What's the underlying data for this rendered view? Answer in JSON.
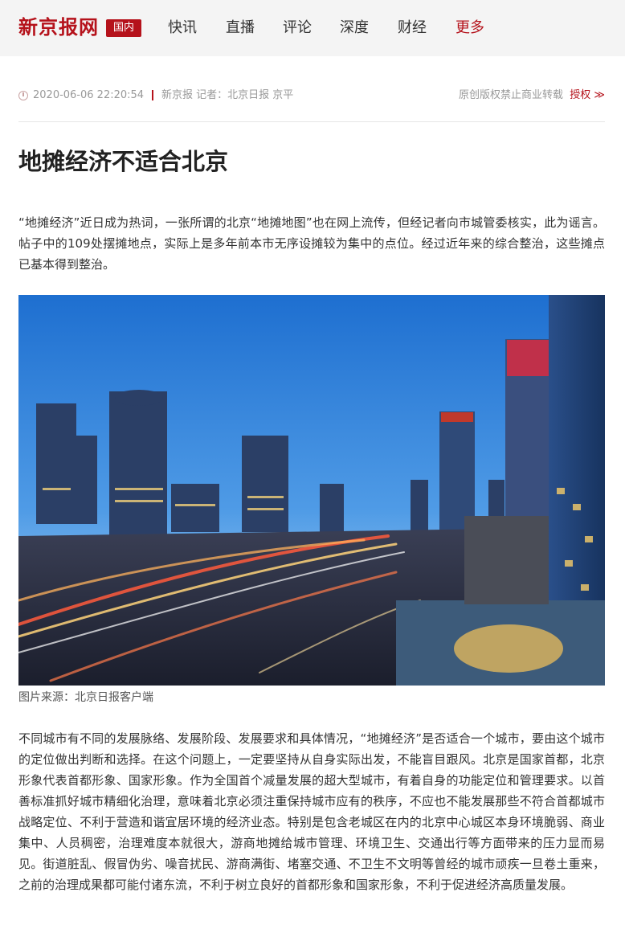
{
  "header": {
    "logo": "新京报网",
    "channel_badge": "国内",
    "nav": [
      "快讯",
      "直播",
      "评论",
      "深度",
      "财经",
      "更多"
    ]
  },
  "meta": {
    "datetime": "2020-06-06 22:20:54",
    "source": "新京报 记者：北京日报 京平",
    "copyright": "原创版权禁止商业转载",
    "license_link": "授权 ≫"
  },
  "article": {
    "title": "地摊经济不适合北京",
    "lead": "“地摊经济”近日成为热词，一张所谓的北京“地摊地图”也在网上流传，但经记者向市城管委核实，此为谣言。帖子中的109处摆摊地点，实际上是多年前本市无序设摊较为集中的点位。经过近年来的综合整治，这些摊点已基本得到整治。",
    "image_caption": "图片来源：北京日报客户端",
    "paragraph_1": "不同城市有不同的发展脉络、发展阶段、发展要求和具体情况，“地摊经济”是否适合一个城市，要由这个城市的定位做出判断和选择。在这个问题上，一定要坚持从自身实际出发，不能盲目跟风。北京是国家首都，北京形象代表首都形象、国家形象。作为全国首个减量发展的超大型城市，有着自身的功能定位和管理要求。以首善标准抓好城市精细化治理，意味着北京必须注重保持城市应有的秩序，不应也不能发展那些不符合首都城市战略定位、不利于营造和谐宜居环境的经济业态。特别是包含老城区在内的北京中心城区本身环境脆弱、商业集中、人员稠密，治理难度本就很大，游商地摊给城市管理、环境卫生、交通出行等方面带来的压力显而易见。街道脏乱、假冒伪劣、噪音扰民、游商满街、堵塞交通、不卫生不文明等曾经的城市顽疾一旦卷土重来，之前的治理成果都可能付诸东流，不利于树立良好的首都形象和国家形象，不利于促进经济高质量发展。"
  },
  "colors": {
    "brand_red": "#b5121b",
    "topbar_bg": "#f4f4f4",
    "meta_gray": "#999999"
  }
}
